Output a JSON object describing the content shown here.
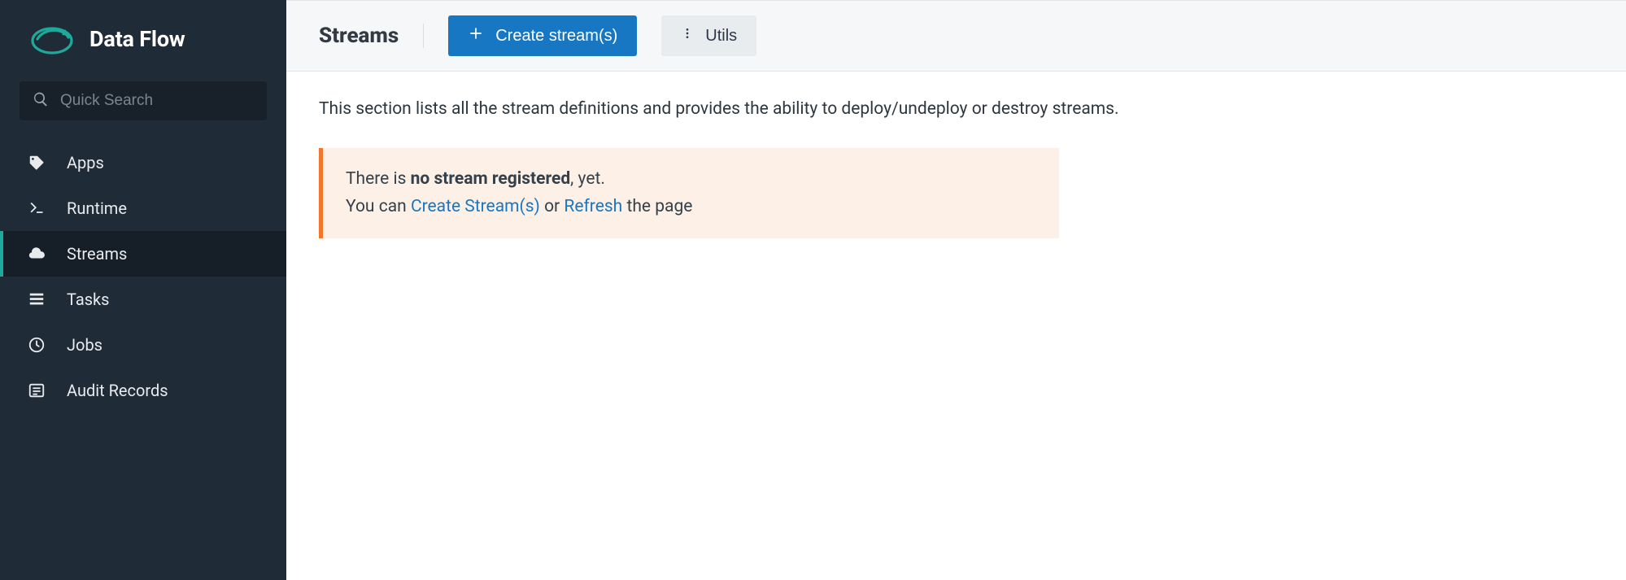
{
  "brand": {
    "name": "Data Flow"
  },
  "search": {
    "placeholder": "Quick Search"
  },
  "nav": {
    "items": [
      {
        "label": "Apps"
      },
      {
        "label": "Runtime"
      },
      {
        "label": "Streams"
      },
      {
        "label": "Tasks"
      },
      {
        "label": "Jobs"
      },
      {
        "label": "Audit Records"
      }
    ],
    "active_index": 2
  },
  "header": {
    "title": "Streams",
    "create_label": "Create stream(s)",
    "utils_label": "Utils"
  },
  "main": {
    "description": "This section lists all the stream definitions and provides the ability to deploy/undeploy or destroy streams."
  },
  "empty": {
    "line1_pre": "There is ",
    "line1_strong": "no stream registered",
    "line1_post": ", yet.",
    "line2_pre": "You can ",
    "create_link": "Create Stream(s)",
    "or_text": " or ",
    "refresh_link": "Refresh",
    "line2_post": " the page"
  },
  "colors": {
    "sidebar_bg": "#1F2B36",
    "accent": "#1ea99a",
    "primary": "#1877c2",
    "warning_border": "#f0772c",
    "warning_bg": "#fdf1e7"
  }
}
